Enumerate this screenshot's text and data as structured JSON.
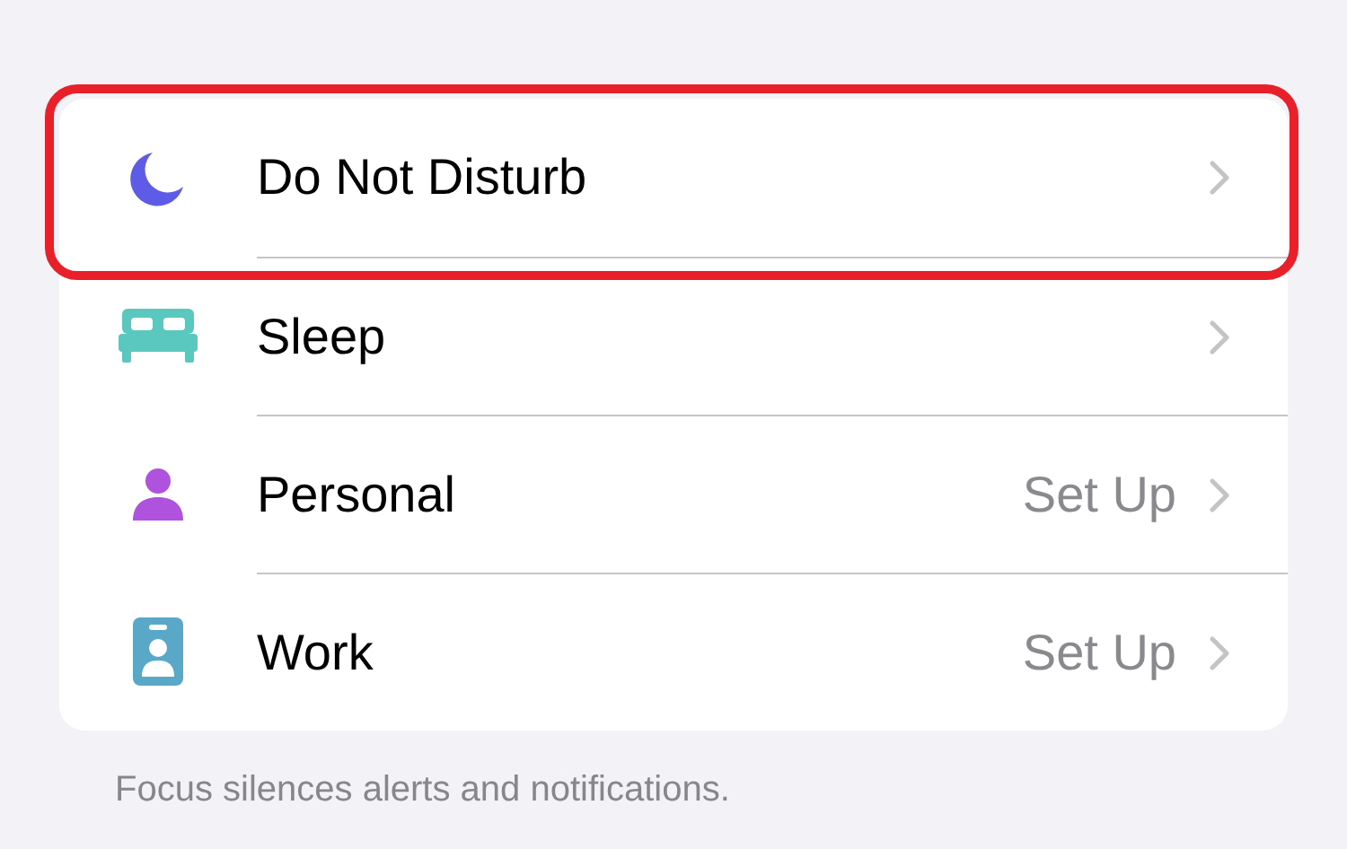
{
  "focus_modes": [
    {
      "kind": "moon",
      "label": "Do Not Disturb",
      "color": "#5e5ce6",
      "highlighted": true
    },
    {
      "kind": "bed",
      "label": "Sleep",
      "color": "#5ac8be",
      "highlighted": false
    },
    {
      "kind": "person",
      "label": "Personal",
      "detail": "Set Up",
      "color": "#af52de",
      "highlighted": false
    },
    {
      "kind": "badge",
      "label": "Work",
      "detail": "Set Up",
      "color": "#5aa8c8",
      "highlighted": false
    }
  ],
  "footer": "Focus silences alerts and notifications."
}
